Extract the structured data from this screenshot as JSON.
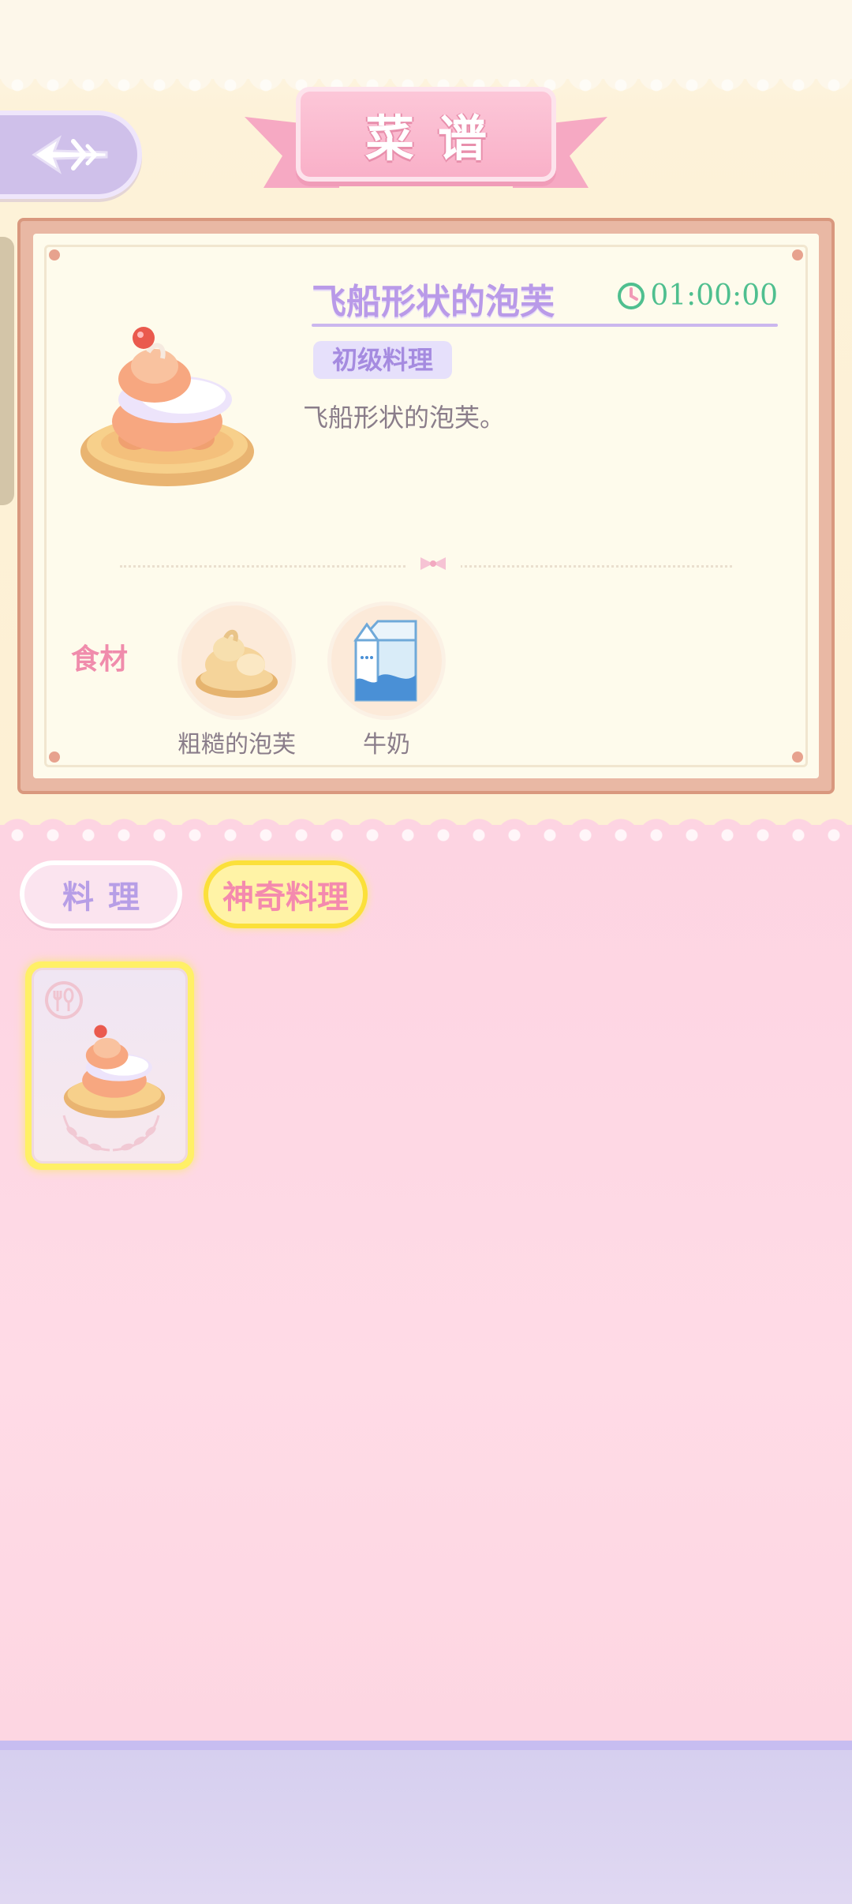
{
  "header": {
    "title": "菜谱"
  },
  "recipe": {
    "name": "飞船形状的泡芙",
    "timer": "01:00:00",
    "level": "初级料理",
    "description": "飞船形状的泡芙。",
    "ingredients_label": "食材",
    "ingredients": [
      {
        "name": "粗糙的泡芙",
        "icon": "puff-icon"
      },
      {
        "name": "牛奶",
        "icon": "milk-carton-icon"
      }
    ]
  },
  "tabs": [
    {
      "label": "料理",
      "selected": false
    },
    {
      "label": "神奇料理",
      "selected": true
    }
  ],
  "list": {
    "items": [
      {
        "icon": "cream-puff-icon",
        "selected": true
      }
    ]
  },
  "colors": {
    "title_pink": "#f9b0c8",
    "dish_name_purple": "#b99ae8",
    "timer_green": "#4fbf8f",
    "ingredient_label_pink": "#f08cac",
    "selected_tab_yellow": "#fbe03a"
  }
}
